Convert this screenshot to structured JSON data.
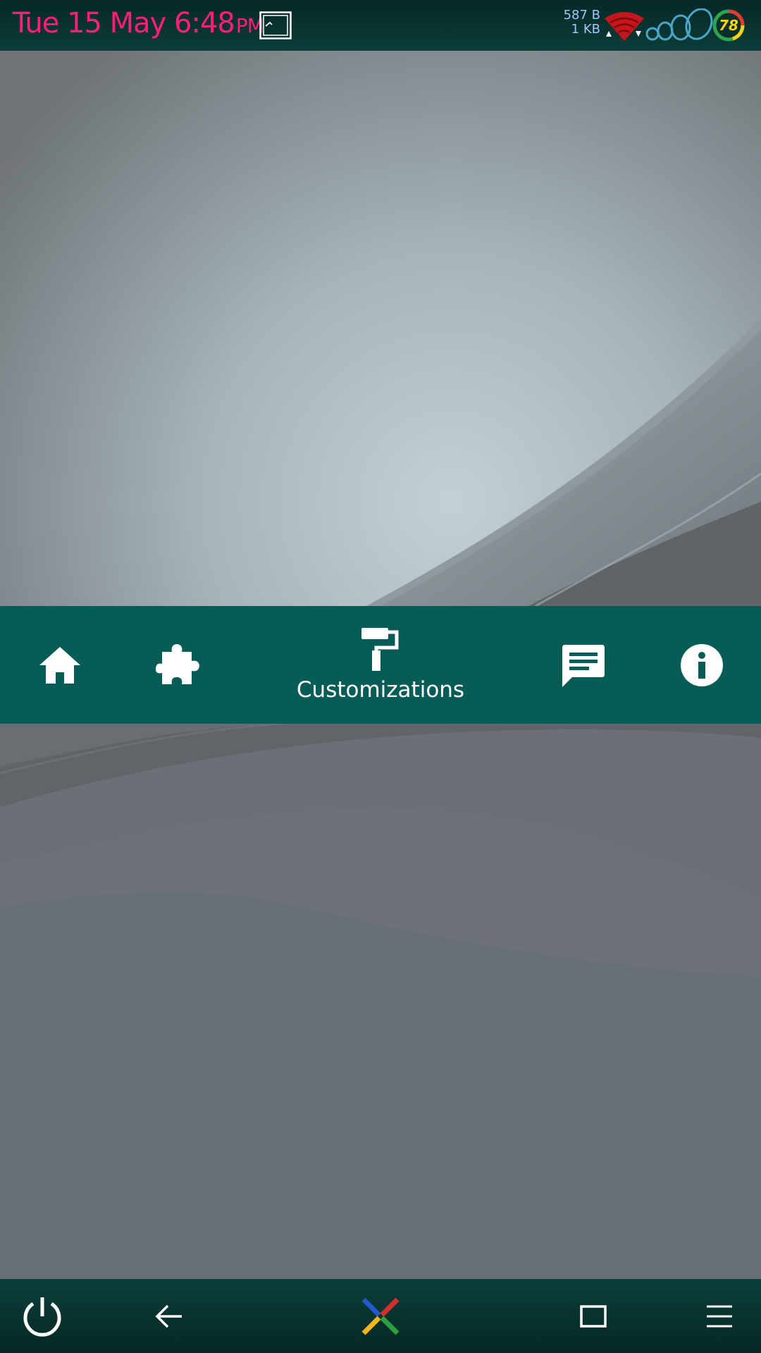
{
  "status_bar": {
    "clock": "Tue 15 May 6:48",
    "ampm": "PM",
    "net_up": "587 B",
    "net_down": "1 KB",
    "battery_level": "78",
    "icons": [
      "screenshot-icon",
      "wifi-icon",
      "signal-icon",
      "battery-icon"
    ],
    "colors": {
      "clock": "#ff1f7a",
      "net_speed": "#9fc6ff",
      "battery_text": "#f4d21a"
    }
  },
  "app_nav": {
    "background": "#075d56",
    "items": [
      {
        "icon": "home-icon",
        "label": ""
      },
      {
        "icon": "puzzle-icon",
        "label": ""
      },
      {
        "icon": "paint-roller-icon",
        "label": "Customizations",
        "selected": true
      },
      {
        "icon": "chat-icon",
        "label": ""
      },
      {
        "icon": "info-icon",
        "label": ""
      }
    ]
  },
  "system_nav": {
    "buttons": [
      "power-icon",
      "back-arrow-icon",
      "app-logo-icon",
      "recents-icon",
      "menu-icon"
    ]
  }
}
